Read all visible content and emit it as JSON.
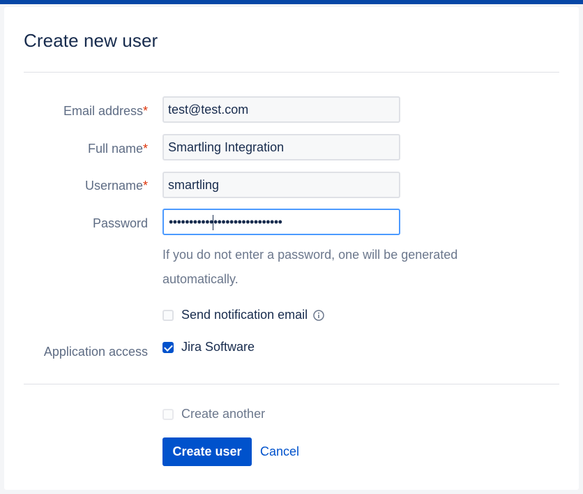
{
  "dialog": {
    "title": "Create new user"
  },
  "form": {
    "email": {
      "label": "Email address",
      "required_mark": "*",
      "value": "test@test.com"
    },
    "fullname": {
      "label": "Full name",
      "required_mark": "*",
      "value": "Smartling Integration"
    },
    "username": {
      "label": "Username",
      "required_mark": "*",
      "value": "smartling"
    },
    "password": {
      "label": "Password",
      "masked_value": "••••••••••••••••••••••••••••",
      "hint": "If you do not enter a password, one will be generated automatically."
    },
    "send_notification": {
      "label": "Send notification email",
      "checked": false,
      "info_icon": "info-icon"
    },
    "application_access": {
      "label": "Application access",
      "items": [
        {
          "label": "Jira Software",
          "checked": true
        }
      ]
    },
    "create_another": {
      "label": "Create another",
      "checked": false
    }
  },
  "actions": {
    "submit_label": "Create user",
    "cancel_label": "Cancel"
  },
  "colors": {
    "primary": "#0052cc",
    "topbar": "#0747a6",
    "required": "#de350b",
    "focus_border": "#4c9aff"
  }
}
